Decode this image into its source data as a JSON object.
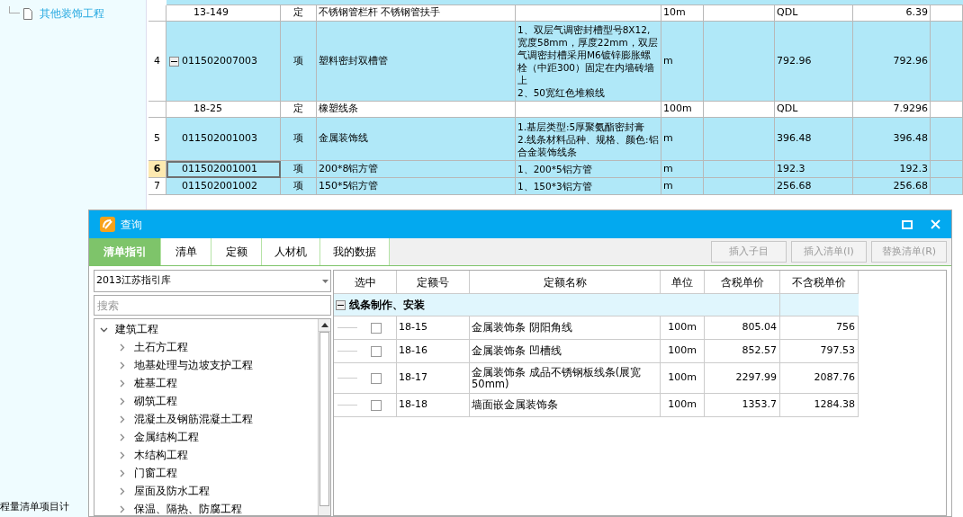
{
  "sidebar": {
    "items": [
      {
        "label": "其他装饰工程",
        "selected": false
      }
    ]
  },
  "bill_table": {
    "rows": [
      {
        "kind": "quota",
        "row_number": "",
        "code": "13-149",
        "type": "定",
        "name": "不锈钢管栏杆 不锈钢管扶手",
        "features": "",
        "unit": "10m",
        "qdl": "QDL",
        "value": "6.39",
        "selected": false
      },
      {
        "kind": "item",
        "row_number": "4",
        "code": "011502007003",
        "type": "项",
        "name": "塑料密封双槽管",
        "features": "1、双层气调密封槽型号8X12,宽度58mm，厚度22mm，双层气调密封槽采用M6镀锌膨胀螺栓（中距300）固定在内墙砖墙上\n2、50宽红色堆粮线",
        "unit": "m",
        "qdl": "792.96",
        "value": "792.96",
        "selected": false,
        "expanded": true
      },
      {
        "kind": "quota",
        "row_number": "",
        "code": "18-25",
        "type": "定",
        "name": "橡塑线条",
        "features": "",
        "unit": "100m",
        "qdl": "QDL",
        "value": "7.9296",
        "selected": false
      },
      {
        "kind": "item",
        "row_number": "5",
        "code": "011502001003",
        "type": "项",
        "name": "金属装饰线",
        "features": "1.基层类型:5厚聚氨酯密封膏\n2.线条材料品种、规格、颜色:铝合金装饰线条",
        "unit": "m",
        "qdl": "396.48",
        "value": "396.48",
        "selected": false
      },
      {
        "kind": "item",
        "row_number": "6",
        "code": "011502001001",
        "type": "项",
        "name": "200*8铝方管",
        "features": "1、200*5铝方管",
        "unit": "m",
        "qdl": "192.3",
        "value": "192.3",
        "selected": true
      },
      {
        "kind": "item",
        "row_number": "7",
        "code": "011502001002",
        "type": "项",
        "name": "150*5铝方管",
        "features": "1、150*3铝方管",
        "unit": "m",
        "qdl": "256.68",
        "value": "256.68",
        "selected": false
      }
    ]
  },
  "status_text": "程量清单项目计",
  "dialog": {
    "title": "查询",
    "tabs": [
      {
        "label": "清单指引",
        "selected": true
      },
      {
        "label": "清单",
        "selected": false
      },
      {
        "label": "定额",
        "selected": false
      },
      {
        "label": "人材机",
        "selected": false
      },
      {
        "label": "我的数据",
        "selected": false
      }
    ],
    "buttons": [
      {
        "label": "插入子目",
        "disabled": true
      },
      {
        "label": "插入清单(I)",
        "disabled": true
      },
      {
        "label": "替换清单(R)",
        "disabled": true
      }
    ],
    "library": "2013江苏指引库",
    "search": {
      "placeholder": "搜索"
    },
    "tree": [
      {
        "label": "建筑工程",
        "expanded": true,
        "children": [
          {
            "label": "土石方工程"
          },
          {
            "label": "地基处理与边坡支护工程"
          },
          {
            "label": "桩基工程"
          },
          {
            "label": "砌筑工程"
          },
          {
            "label": "混凝土及钢筋混凝土工程"
          },
          {
            "label": "金属结构工程"
          },
          {
            "label": "木结构工程"
          },
          {
            "label": "门窗工程"
          },
          {
            "label": "屋面及防水工程"
          },
          {
            "label": "保温、隔热、防腐工程"
          }
        ]
      }
    ],
    "grid": {
      "columns": [
        "选中",
        "定额号",
        "定额名称",
        "单位",
        "含税单价",
        "不含税单价"
      ],
      "group": {
        "label": "线条制作、安装",
        "expanded": true
      },
      "rows": [
        {
          "checked": false,
          "code": "18-15",
          "name": "金属装饰条 阴阳角线",
          "unit": "100m",
          "price_tax": "805.04",
          "price_no_tax": "756"
        },
        {
          "checked": false,
          "code": "18-16",
          "name": "金属装饰条 凹槽线",
          "unit": "100m",
          "price_tax": "852.57",
          "price_no_tax": "797.53"
        },
        {
          "checked": false,
          "code": "18-17",
          "name": "金属装饰条 成品不锈钢板线条(展宽50mm)",
          "unit": "100m",
          "price_tax": "2297.99",
          "price_no_tax": "2087.76"
        },
        {
          "checked": false,
          "code": "18-18",
          "name": "墙面嵌金属装饰条",
          "unit": "100m",
          "price_tax": "1353.7",
          "price_no_tax": "1284.38"
        }
      ]
    }
  }
}
